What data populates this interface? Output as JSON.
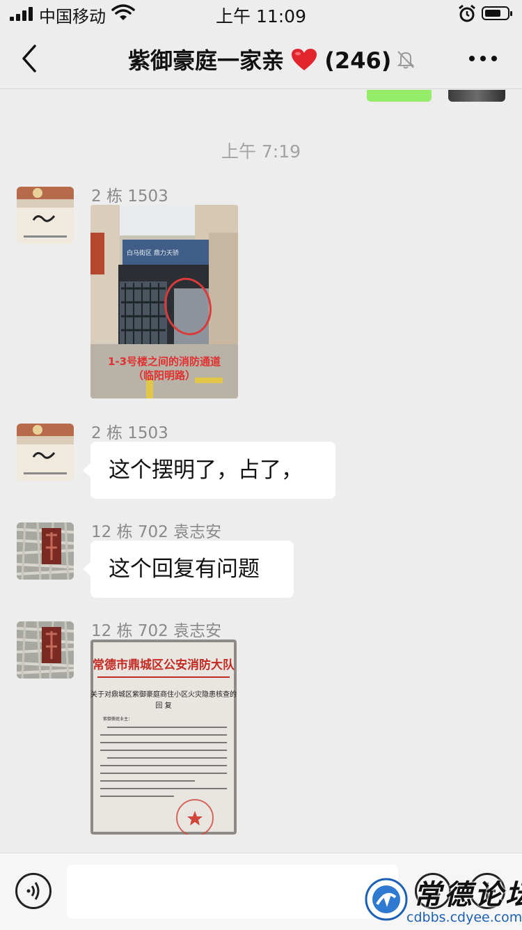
{
  "status_bar": {
    "carrier": "中国移动",
    "time": "上午 11:09",
    "icons": [
      "signal-icon",
      "wifi-icon",
      "alarm-icon",
      "battery-icon"
    ]
  },
  "nav": {
    "title": "紫御豪庭一家亲",
    "member_count": "(246)",
    "icons": [
      "back-icon",
      "heart-icon",
      "mute-bell-icon",
      "more-icon"
    ]
  },
  "chat": {
    "timestamp": "上午 7:19",
    "messages": [
      {
        "sender": "2 栋 1503",
        "type": "image",
        "image_caption_lines": [
          "1-3号楼之间的消防通道",
          "（临阳明路）"
        ],
        "image_sign": "白马街区 鼎力天骄"
      },
      {
        "sender": "2 栋 1503",
        "type": "text",
        "text": "这个摆明了，占了，"
      },
      {
        "sender": "12 栋 702 袁志安",
        "type": "text",
        "text": "这个回复有问题"
      },
      {
        "sender": "12 栋 702 袁志安",
        "type": "image",
        "doc_header": "常德市鼎城区公安消防大队",
        "doc_subtitle_lines": [
          "关于对鼎城区紫御豪庭商住小区火灾隐患核查的",
          "回  复"
        ],
        "doc_salutation": "紫御豪庭业主："
      }
    ]
  },
  "input_bar": {
    "placeholder": "",
    "icons": [
      "voice-icon",
      "emoji-icon",
      "plus-icon"
    ]
  },
  "watermark": {
    "text": "常德论坛",
    "url": "cdbbs.cdyee.com"
  },
  "colors": {
    "background": "#ededed",
    "bubble": "#ffffff",
    "self_bubble": "#95ec69",
    "heart": "#e0252d",
    "timestamp": "#a3a3a3",
    "watermark_url": "#1a5fb4",
    "doc_header_red": "#c42a22"
  }
}
